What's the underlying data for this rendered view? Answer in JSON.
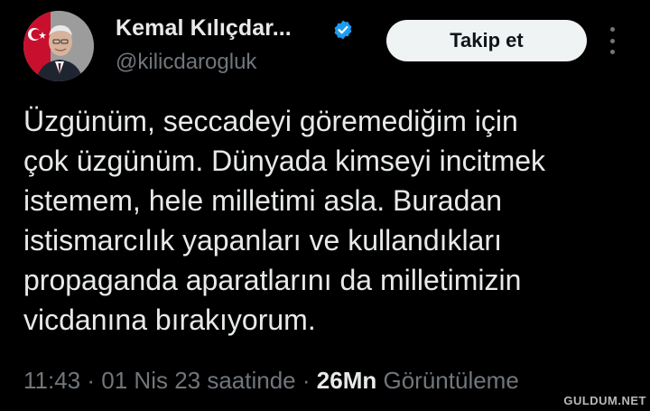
{
  "author": {
    "display_name": "Kemal Kılıçdar...",
    "handle": "@kilicdarogluk",
    "verified": true
  },
  "follow_button": {
    "label": "Takip et"
  },
  "more_menu": {
    "icon": "more-vertical-icon"
  },
  "tweet": {
    "lines": [
      "Üzgünüm, seccadeyi göremediğim için",
      "çok üzgünüm. Dünyada kimseyi incitmek",
      "istemem, hele milletimi asla. Buradan",
      "istismarcılık yapanları ve kullandıkları",
      "propaganda aparatlarını da milletimizin",
      "vicdanına bırakıyorum."
    ],
    "time": "11:43",
    "separator": "·",
    "date": "01 Nis 23 saatinde",
    "views_count": "26Mn",
    "views_label": "Görüntüleme"
  },
  "watermark": {
    "text": "GULDUM.NET"
  },
  "colors": {
    "background": "#000000",
    "text": "#e7e9ea",
    "secondary_text": "#71767b",
    "verified_badge": "#1d9bf0",
    "button_bg": "#eff3f4"
  }
}
